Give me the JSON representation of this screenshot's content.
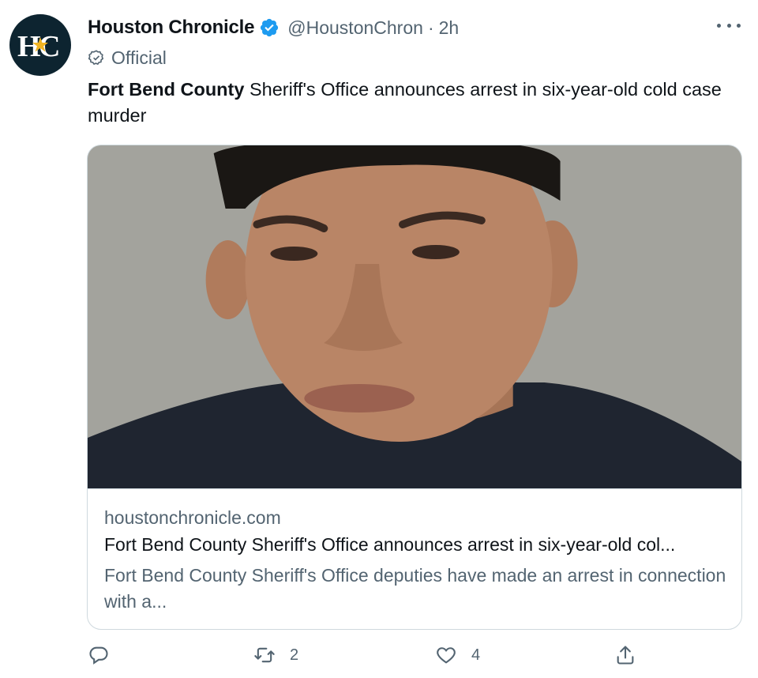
{
  "tweet": {
    "author_name": "Houston Chronicle",
    "author_handle": "@HoustonChron",
    "separator": "·",
    "time": "2h",
    "badge_label": "Official",
    "text_bold": "Fort Bend County",
    "text_rest": " Sheriff's Office announces arrest in six-year-old cold case murder"
  },
  "card": {
    "image_alt": "mugshot-photo",
    "domain": "houstonchronicle.com",
    "title": "Fort Bend County Sheriff's Office announces arrest in six-year-old col...",
    "description": "Fort Bend County Sheriff's Office deputies have made an arrest in connection with a..."
  },
  "actions": {
    "reply_count": "",
    "retweet_count": "2",
    "like_count": "4",
    "share_count": ""
  },
  "colors": {
    "verified": "#1d9bf0",
    "avatar_bg": "#0d2430",
    "secondary_text": "#536471"
  }
}
